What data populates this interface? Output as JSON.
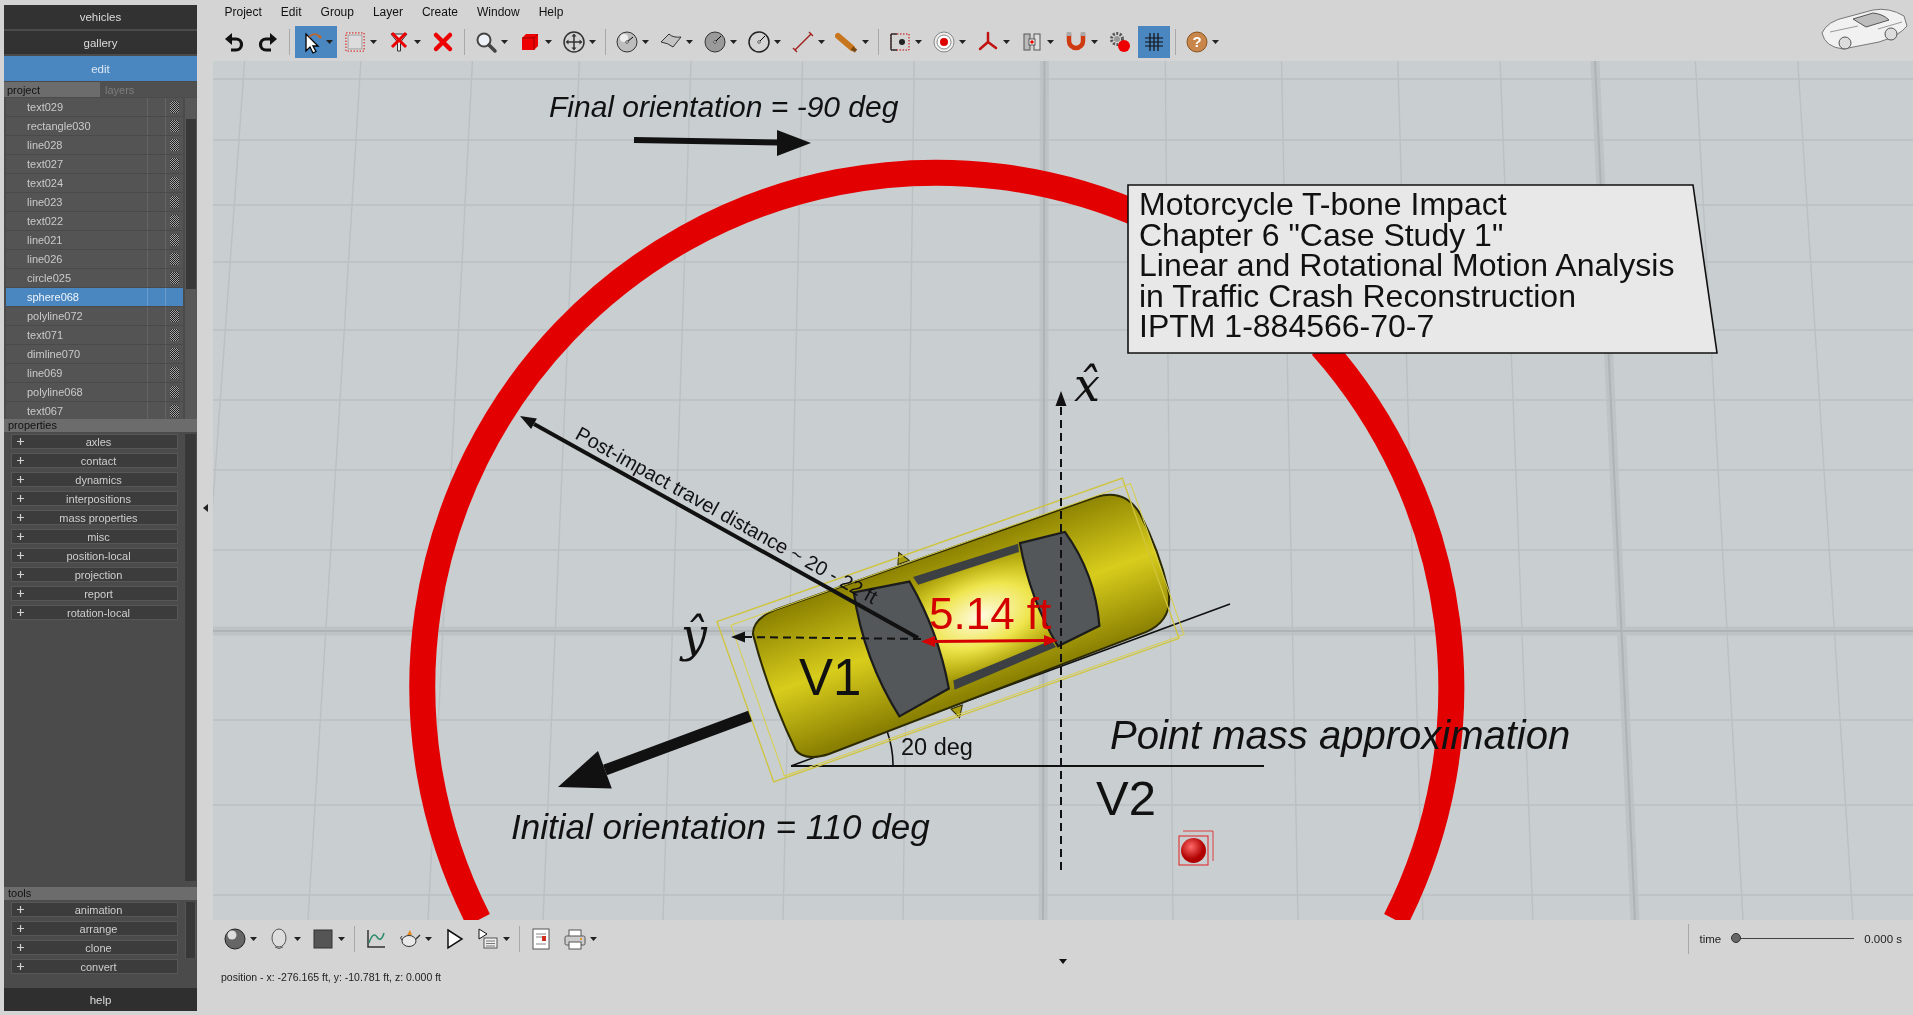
{
  "sidebar": {
    "nav": [
      {
        "label": "vehicles",
        "selected": false
      },
      {
        "label": "gallery",
        "selected": false
      },
      {
        "label": "edit",
        "selected": true
      }
    ],
    "tabs": [
      {
        "label": "project",
        "selected": true
      },
      {
        "label": "layers",
        "selected": false
      }
    ],
    "objects": [
      {
        "name": "text029",
        "selected": false
      },
      {
        "name": "rectangle030",
        "selected": false
      },
      {
        "name": "line028",
        "selected": false
      },
      {
        "name": "text027",
        "selected": false
      },
      {
        "name": "text024",
        "selected": false
      },
      {
        "name": "line023",
        "selected": false
      },
      {
        "name": "text022",
        "selected": false
      },
      {
        "name": "line021",
        "selected": false
      },
      {
        "name": "line026",
        "selected": false
      },
      {
        "name": "circle025",
        "selected": false
      },
      {
        "name": "sphere068",
        "selected": true
      },
      {
        "name": "polyline072",
        "selected": false
      },
      {
        "name": "text071",
        "selected": false
      },
      {
        "name": "dimline070",
        "selected": false
      },
      {
        "name": "line069",
        "selected": false
      },
      {
        "name": "polyline068",
        "selected": false
      },
      {
        "name": "text067",
        "selected": false
      }
    ],
    "properties": {
      "title": "properties",
      "items": [
        {
          "label": "axles",
          "expanded": false
        },
        {
          "label": "contact",
          "expanded": false
        },
        {
          "label": "dynamics",
          "expanded": false
        },
        {
          "label": "interpositions",
          "expanded": false
        },
        {
          "label": "mass properties",
          "expanded": false
        },
        {
          "label": "misc",
          "expanded": false
        },
        {
          "label": "position-local",
          "expanded": false
        },
        {
          "label": "projection",
          "expanded": false
        },
        {
          "label": "report",
          "expanded": false
        },
        {
          "label": "rotation-local",
          "expanded": false
        }
      ]
    },
    "tools": {
      "title": "tools",
      "items": [
        {
          "label": "animation",
          "expanded": false
        },
        {
          "label": "arrange",
          "expanded": false
        },
        {
          "label": "clone",
          "expanded": false
        },
        {
          "label": "convert",
          "expanded": false
        }
      ]
    },
    "help": "help"
  },
  "menu": [
    "Project",
    "Edit",
    "Group",
    "Layer",
    "Create",
    "Window",
    "Help"
  ],
  "toolbar": [
    [
      {
        "selected": false,
        "dropdown": false
      },
      {
        "selected": false,
        "dropdown": false
      }
    ],
    [
      {
        "selected": true,
        "dropdown": true
      },
      {
        "selected": false,
        "dropdown": true
      },
      {
        "selected": false,
        "dropdown": true
      },
      {
        "selected": false,
        "dropdown": false
      }
    ],
    [
      {
        "selected": false,
        "dropdown": true
      },
      {
        "selected": false,
        "dropdown": true
      },
      {
        "selected": false,
        "dropdown": true
      }
    ],
    [
      {
        "selected": false,
        "dropdown": true
      },
      {
        "selected": false,
        "dropdown": true
      },
      {
        "selected": false,
        "dropdown": true
      },
      {
        "selected": false,
        "dropdown": true
      },
      {
        "selected": false,
        "dropdown": true
      },
      {
        "selected": false,
        "dropdown": true
      }
    ],
    [
      {
        "selected": false,
        "dropdown": true
      },
      {
        "selected": false,
        "dropdown": true
      },
      {
        "selected": false,
        "dropdown": true
      },
      {
        "selected": false,
        "dropdown": true
      },
      {
        "selected": false,
        "dropdown": true
      },
      {
        "selected": false,
        "dropdown": false
      },
      {
        "selected": true,
        "dropdown": false
      }
    ],
    [
      {
        "selected": false,
        "dropdown": true,
        "glyph": "?"
      }
    ]
  ],
  "viewport": {
    "final_orientation": "Final orientation = -90 deg",
    "caption": [
      "Motorcycle T-bone Impact",
      "Chapter 6 \"Case Study 1\"",
      "Linear and Rotational Motion Analysis",
      "in Traffic Crash Reconstruction",
      "IPTM 1-884566-70-7"
    ],
    "x_axis_label": "x̂",
    "travel_label": "Post-impact travel distance ~ 20 - 22 ft",
    "y_axis_label": "ŷ",
    "dimension_label": "5.14 ft",
    "v1_label": "V1",
    "angle_label": "20 deg",
    "point_mass_label": "Point mass approximation",
    "v2_label": "V2",
    "initial_orientation": "Initial orientation = 110 deg"
  },
  "bottom_toolbar": [
    [
      {
        "selected": false,
        "dropdown": true
      },
      {
        "selected": false,
        "dropdown": true
      },
      {
        "selected": false,
        "dropdown": true
      }
    ],
    [
      {
        "selected": false,
        "dropdown": false
      },
      {
        "selected": false,
        "dropdown": true
      },
      {
        "selected": false,
        "dropdown": false
      },
      {
        "selected": false,
        "dropdown": true
      }
    ],
    [
      {
        "selected": false,
        "dropdown": false
      },
      {
        "selected": false,
        "dropdown": true
      }
    ]
  ],
  "time": {
    "label": "time",
    "level": 0,
    "reading": "0.000 s"
  },
  "status_bar": "position - x: -276.165 ft, y: -10.781 ft, z: 0.000 ft"
}
